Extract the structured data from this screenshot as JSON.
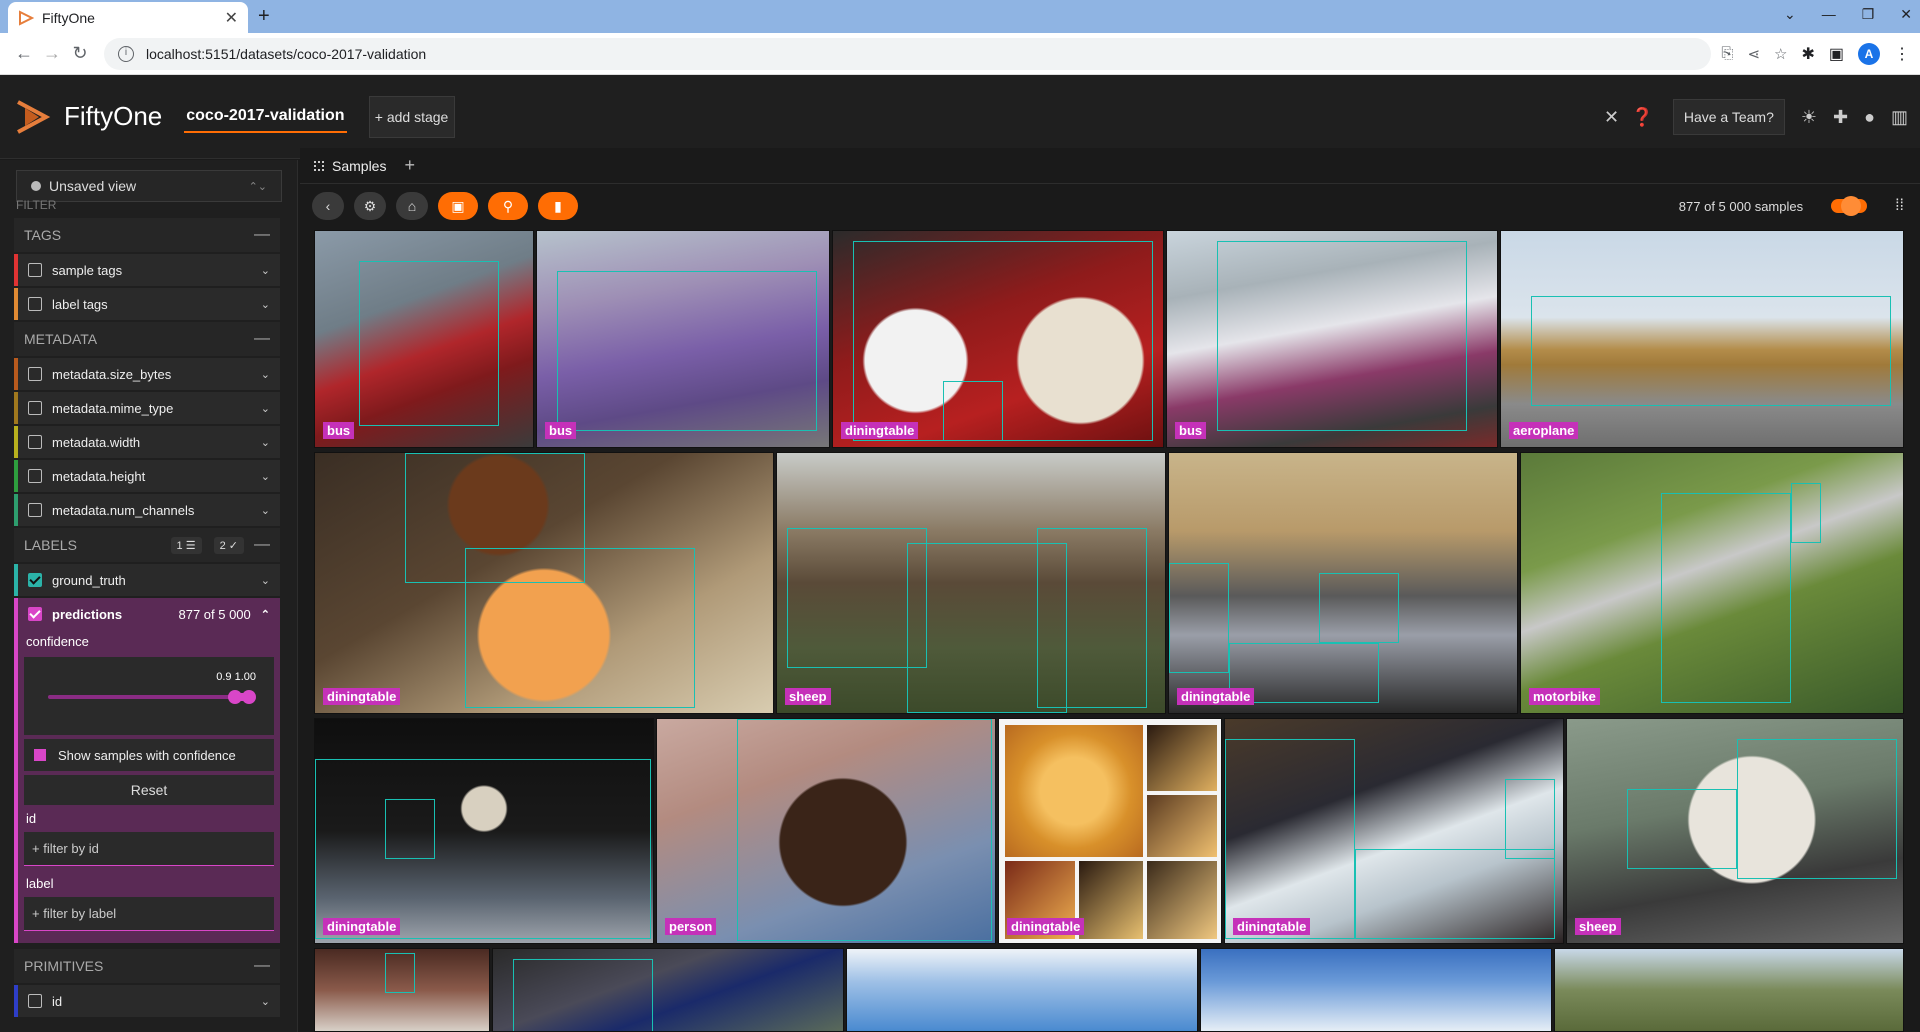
{
  "browser": {
    "tab_title": "FiftyOne",
    "url": "localhost:5151/datasets/coco-2017-validation",
    "profile_initial": "A"
  },
  "header": {
    "brand": "FiftyOne",
    "dataset": "coco-2017-validation",
    "add_stage": "+ add stage",
    "team_button": "Have a Team?"
  },
  "sidebar": {
    "view_select": "Unsaved view",
    "filter_label": "FILTER",
    "tags": {
      "title": "TAGS",
      "items": [
        {
          "label": "sample tags",
          "color": "#e03333"
        },
        {
          "label": "label tags",
          "color": "#e08a33"
        }
      ]
    },
    "metadata": {
      "title": "METADATA",
      "items": [
        {
          "label": "metadata.size_bytes",
          "color": "#b85a1e"
        },
        {
          "label": "metadata.mime_type",
          "color": "#a0781e"
        },
        {
          "label": "metadata.width",
          "color": "#b8b01e"
        },
        {
          "label": "metadata.height",
          "color": "#2e9e3e"
        },
        {
          "label": "metadata.num_channels",
          "color": "#2e9e6e"
        }
      ]
    },
    "labels": {
      "title": "LABELS",
      "pill1": "1",
      "pill2": "2",
      "ground_truth": "ground_truth",
      "predictions": "predictions",
      "predictions_count": "877 of 5 000",
      "confidence_label": "confidence",
      "slider_min": "0.9",
      "slider_max": "1.00",
      "show_samples": "Show samples with confidence",
      "reset": "Reset",
      "id_label": "id",
      "id_placeholder": "+ filter by id",
      "label_label": "label",
      "label_placeholder": "+ filter by label"
    },
    "primitives": {
      "title": "PRIMITIVES",
      "items": [
        {
          "label": "id",
          "color": "#2e3ec8"
        }
      ]
    }
  },
  "main": {
    "samples_tab": "Samples",
    "sample_count": "877 of 5 000 samples"
  },
  "tiles": [
    {
      "label": "bus"
    },
    {
      "label": "bus"
    },
    {
      "label": "diningtable"
    },
    {
      "label": "bus"
    },
    {
      "label": "aeroplane"
    },
    {
      "label": "diningtable"
    },
    {
      "label": "sheep"
    },
    {
      "label": "diningtable"
    },
    {
      "label": "motorbike"
    },
    {
      "label": "diningtable"
    },
    {
      "label": "person"
    },
    {
      "label": "diningtable"
    },
    {
      "label": "diningtable"
    },
    {
      "label": "sheep"
    },
    {
      "label": ""
    },
    {
      "label": ""
    },
    {
      "label": ""
    },
    {
      "label": ""
    },
    {
      "label": ""
    }
  ],
  "colors": {
    "accent": "#ff6d04",
    "label_pink": "#c531b9",
    "bbox_teal": "#19c0b3"
  }
}
